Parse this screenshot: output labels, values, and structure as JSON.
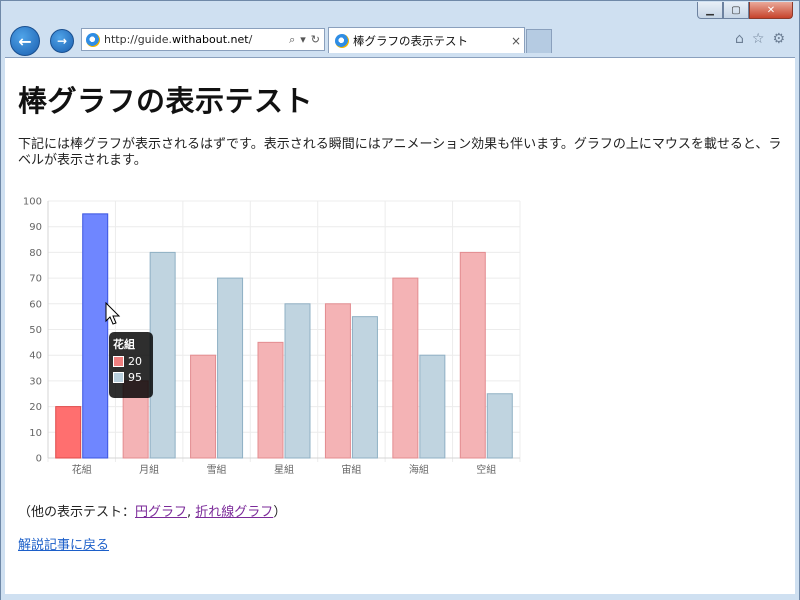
{
  "window": {
    "minimize_label": "▁",
    "maximize_label": "▢",
    "close_label": "✕"
  },
  "nav": {
    "back_icon": "←",
    "forward_icon": "→",
    "url_prefix": "http://guide.",
    "url_domain": "withabout.net",
    "url_suffix": "/",
    "search_icon": "⌕",
    "dropdown_icon": "▾",
    "refresh_icon": "↻"
  },
  "tab": {
    "title": "棒グラフの表示テスト",
    "close_label": "×"
  },
  "toolbar": {
    "home_icon": "⌂",
    "favorites_icon": "☆",
    "settings_icon": "⚙"
  },
  "page": {
    "title": "棒グラフの表示テスト",
    "intro": "下記には棒グラフが表示されるはずです。表示される瞬間にはアニメーション効果も伴います。グラフの上にマウスを載せると、ラベルが表示されます。",
    "other_prefix": "（他の表示テスト：",
    "link_pie": "円グラフ",
    "link_sep": ", ",
    "link_line": "折れ線グラフ",
    "other_suffix": "）",
    "back_link": "解説記事に戻る"
  },
  "tooltip": {
    "title": "花組",
    "row1": "20",
    "row2": "95",
    "color1": "#f08080",
    "color2": "#b8cfdc"
  },
  "chart_data": {
    "type": "bar",
    "categories": [
      "花組",
      "月組",
      "雪組",
      "星組",
      "宙組",
      "海組",
      "空組"
    ],
    "series": [
      {
        "values": [
          20,
          30,
          40,
          45,
          60,
          70,
          80
        ],
        "color": "#f4b3b5",
        "stroke": "#e38c90"
      },
      {
        "values": [
          95,
          80,
          70,
          60,
          55,
          40,
          25
        ],
        "color": "#c0d4e0",
        "stroke": "#8fb0c4"
      }
    ],
    "highlight": {
      "category_index": 0,
      "colors": [
        "#ff6f6f",
        "#6f86ff"
      ]
    },
    "yticks": [
      0,
      10,
      20,
      30,
      40,
      50,
      60,
      70,
      80,
      90,
      100
    ],
    "ylim": [
      0,
      100
    ],
    "grid": true
  }
}
